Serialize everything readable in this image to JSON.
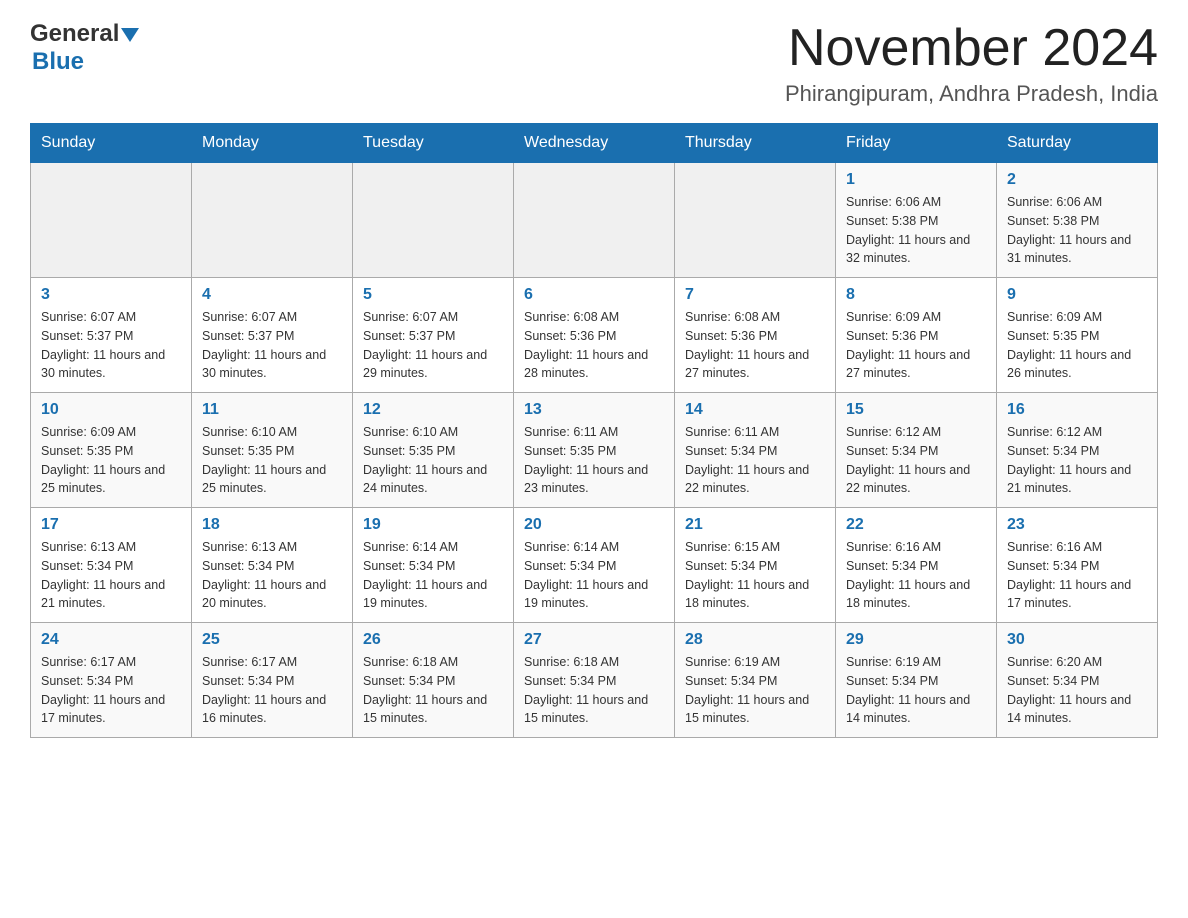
{
  "header": {
    "logo_general": "General",
    "logo_blue": "Blue",
    "month_title": "November 2024",
    "location": "Phirangipuram, Andhra Pradesh, India"
  },
  "weekdays": [
    "Sunday",
    "Monday",
    "Tuesday",
    "Wednesday",
    "Thursday",
    "Friday",
    "Saturday"
  ],
  "weeks": [
    [
      {
        "day": "",
        "info": ""
      },
      {
        "day": "",
        "info": ""
      },
      {
        "day": "",
        "info": ""
      },
      {
        "day": "",
        "info": ""
      },
      {
        "day": "",
        "info": ""
      },
      {
        "day": "1",
        "info": "Sunrise: 6:06 AM\nSunset: 5:38 PM\nDaylight: 11 hours and 32 minutes."
      },
      {
        "day": "2",
        "info": "Sunrise: 6:06 AM\nSunset: 5:38 PM\nDaylight: 11 hours and 31 minutes."
      }
    ],
    [
      {
        "day": "3",
        "info": "Sunrise: 6:07 AM\nSunset: 5:37 PM\nDaylight: 11 hours and 30 minutes."
      },
      {
        "day": "4",
        "info": "Sunrise: 6:07 AM\nSunset: 5:37 PM\nDaylight: 11 hours and 30 minutes."
      },
      {
        "day": "5",
        "info": "Sunrise: 6:07 AM\nSunset: 5:37 PM\nDaylight: 11 hours and 29 minutes."
      },
      {
        "day": "6",
        "info": "Sunrise: 6:08 AM\nSunset: 5:36 PM\nDaylight: 11 hours and 28 minutes."
      },
      {
        "day": "7",
        "info": "Sunrise: 6:08 AM\nSunset: 5:36 PM\nDaylight: 11 hours and 27 minutes."
      },
      {
        "day": "8",
        "info": "Sunrise: 6:09 AM\nSunset: 5:36 PM\nDaylight: 11 hours and 27 minutes."
      },
      {
        "day": "9",
        "info": "Sunrise: 6:09 AM\nSunset: 5:35 PM\nDaylight: 11 hours and 26 minutes."
      }
    ],
    [
      {
        "day": "10",
        "info": "Sunrise: 6:09 AM\nSunset: 5:35 PM\nDaylight: 11 hours and 25 minutes."
      },
      {
        "day": "11",
        "info": "Sunrise: 6:10 AM\nSunset: 5:35 PM\nDaylight: 11 hours and 25 minutes."
      },
      {
        "day": "12",
        "info": "Sunrise: 6:10 AM\nSunset: 5:35 PM\nDaylight: 11 hours and 24 minutes."
      },
      {
        "day": "13",
        "info": "Sunrise: 6:11 AM\nSunset: 5:35 PM\nDaylight: 11 hours and 23 minutes."
      },
      {
        "day": "14",
        "info": "Sunrise: 6:11 AM\nSunset: 5:34 PM\nDaylight: 11 hours and 22 minutes."
      },
      {
        "day": "15",
        "info": "Sunrise: 6:12 AM\nSunset: 5:34 PM\nDaylight: 11 hours and 22 minutes."
      },
      {
        "day": "16",
        "info": "Sunrise: 6:12 AM\nSunset: 5:34 PM\nDaylight: 11 hours and 21 minutes."
      }
    ],
    [
      {
        "day": "17",
        "info": "Sunrise: 6:13 AM\nSunset: 5:34 PM\nDaylight: 11 hours and 21 minutes."
      },
      {
        "day": "18",
        "info": "Sunrise: 6:13 AM\nSunset: 5:34 PM\nDaylight: 11 hours and 20 minutes."
      },
      {
        "day": "19",
        "info": "Sunrise: 6:14 AM\nSunset: 5:34 PM\nDaylight: 11 hours and 19 minutes."
      },
      {
        "day": "20",
        "info": "Sunrise: 6:14 AM\nSunset: 5:34 PM\nDaylight: 11 hours and 19 minutes."
      },
      {
        "day": "21",
        "info": "Sunrise: 6:15 AM\nSunset: 5:34 PM\nDaylight: 11 hours and 18 minutes."
      },
      {
        "day": "22",
        "info": "Sunrise: 6:16 AM\nSunset: 5:34 PM\nDaylight: 11 hours and 18 minutes."
      },
      {
        "day": "23",
        "info": "Sunrise: 6:16 AM\nSunset: 5:34 PM\nDaylight: 11 hours and 17 minutes."
      }
    ],
    [
      {
        "day": "24",
        "info": "Sunrise: 6:17 AM\nSunset: 5:34 PM\nDaylight: 11 hours and 17 minutes."
      },
      {
        "day": "25",
        "info": "Sunrise: 6:17 AM\nSunset: 5:34 PM\nDaylight: 11 hours and 16 minutes."
      },
      {
        "day": "26",
        "info": "Sunrise: 6:18 AM\nSunset: 5:34 PM\nDaylight: 11 hours and 15 minutes."
      },
      {
        "day": "27",
        "info": "Sunrise: 6:18 AM\nSunset: 5:34 PM\nDaylight: 11 hours and 15 minutes."
      },
      {
        "day": "28",
        "info": "Sunrise: 6:19 AM\nSunset: 5:34 PM\nDaylight: 11 hours and 15 minutes."
      },
      {
        "day": "29",
        "info": "Sunrise: 6:19 AM\nSunset: 5:34 PM\nDaylight: 11 hours and 14 minutes."
      },
      {
        "day": "30",
        "info": "Sunrise: 6:20 AM\nSunset: 5:34 PM\nDaylight: 11 hours and 14 minutes."
      }
    ]
  ]
}
